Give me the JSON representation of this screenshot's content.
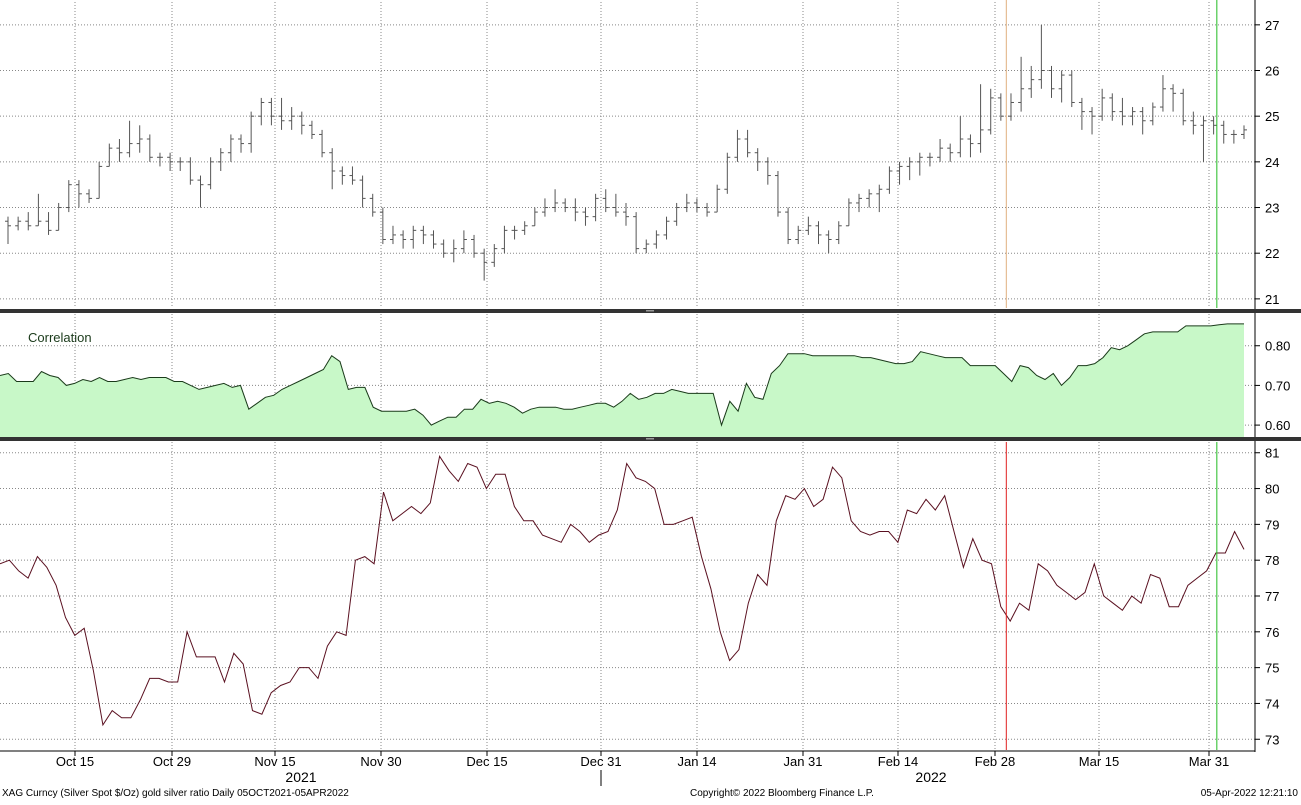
{
  "chart_data": [
    {
      "type": "ohlc",
      "panel": "top",
      "ylim": [
        20.8,
        27.5
      ],
      "yticks": [
        "21",
        "22",
        "23",
        "24",
        "25",
        "26",
        "27"
      ],
      "grid": true,
      "vlines": [
        {
          "x": "2022-03-01",
          "color": "#e0b080"
        },
        {
          "x": "2022-04-01",
          "color": "#22bb22"
        }
      ],
      "x_first": "2021-10-05",
      "x_last": "2022-04-05",
      "x_step_days_approx": 1.3,
      "ohlc": [
        [
          22.7,
          22.8,
          22.2,
          22.6
        ],
        [
          22.6,
          22.8,
          22.5,
          22.7
        ],
        [
          22.7,
          22.9,
          22.5,
          22.6
        ],
        [
          22.6,
          23.3,
          22.6,
          22.7
        ],
        [
          22.7,
          22.9,
          22.4,
          22.5
        ],
        [
          22.5,
          23.1,
          22.5,
          23.0
        ],
        [
          23.0,
          23.6,
          22.9,
          23.5
        ],
        [
          23.5,
          23.6,
          23.0,
          23.3
        ],
        [
          23.3,
          23.4,
          23.1,
          23.2
        ],
        [
          23.2,
          24.0,
          23.2,
          23.9
        ],
        [
          23.9,
          24.4,
          23.9,
          24.3
        ],
        [
          24.3,
          24.5,
          24.0,
          24.2
        ],
        [
          24.2,
          24.9,
          24.1,
          24.4
        ],
        [
          24.4,
          24.8,
          24.2,
          24.5
        ],
        [
          24.5,
          24.6,
          24.0,
          24.1
        ],
        [
          24.1,
          24.2,
          23.9,
          24.1
        ],
        [
          24.1,
          24.2,
          23.8,
          24.0
        ],
        [
          24.0,
          24.1,
          23.8,
          24.0
        ],
        [
          24.0,
          24.1,
          23.5,
          23.6
        ],
        [
          23.6,
          23.7,
          23.0,
          23.5
        ],
        [
          23.5,
          24.1,
          23.4,
          24.0
        ],
        [
          24.0,
          24.3,
          23.8,
          24.2
        ],
        [
          24.2,
          24.6,
          24.0,
          24.5
        ],
        [
          24.5,
          24.6,
          24.2,
          24.4
        ],
        [
          24.4,
          25.1,
          24.2,
          25.0
        ],
        [
          25.0,
          25.4,
          24.8,
          25.3
        ],
        [
          25.3,
          25.4,
          24.8,
          25.0
        ],
        [
          25.0,
          25.4,
          24.7,
          24.9
        ],
        [
          24.9,
          25.2,
          24.7,
          25.0
        ],
        [
          25.0,
          25.1,
          24.6,
          24.8
        ],
        [
          24.8,
          24.9,
          24.5,
          24.6
        ],
        [
          24.6,
          24.7,
          24.1,
          24.2
        ],
        [
          24.2,
          24.3,
          23.4,
          23.8
        ],
        [
          23.8,
          23.9,
          23.5,
          23.7
        ],
        [
          23.7,
          23.9,
          23.5,
          23.6
        ],
        [
          23.6,
          23.7,
          23.0,
          23.2
        ],
        [
          23.2,
          23.3,
          22.8,
          22.9
        ],
        [
          22.9,
          23.0,
          22.2,
          22.3
        ],
        [
          22.3,
          22.6,
          22.2,
          22.4
        ],
        [
          22.4,
          22.5,
          22.1,
          22.3
        ],
        [
          22.3,
          22.6,
          22.1,
          22.5
        ],
        [
          22.5,
          22.6,
          22.2,
          22.4
        ],
        [
          22.4,
          22.5,
          22.1,
          22.2
        ],
        [
          22.2,
          22.3,
          21.9,
          22.0
        ],
        [
          22.0,
          22.3,
          21.8,
          22.1
        ],
        [
          22.1,
          22.5,
          22.0,
          22.3
        ],
        [
          22.3,
          22.4,
          21.9,
          22.0
        ],
        [
          22.0,
          22.1,
          21.4,
          21.8
        ],
        [
          21.8,
          22.2,
          21.7,
          22.1
        ],
        [
          22.1,
          22.6,
          22.0,
          22.5
        ],
        [
          22.5,
          22.6,
          22.3,
          22.5
        ],
        [
          22.5,
          22.7,
          22.4,
          22.6
        ],
        [
          22.6,
          23.0,
          22.6,
          22.9
        ],
        [
          22.9,
          23.2,
          22.8,
          23.0
        ],
        [
          23.0,
          23.4,
          22.9,
          23.1
        ],
        [
          23.1,
          23.2,
          22.9,
          23.0
        ],
        [
          23.0,
          23.2,
          22.7,
          22.9
        ],
        [
          22.9,
          23.0,
          22.6,
          22.8
        ],
        [
          22.8,
          23.3,
          22.7,
          23.2
        ],
        [
          23.2,
          23.4,
          22.9,
          23.0
        ],
        [
          23.0,
          23.3,
          22.8,
          22.9
        ],
        [
          22.9,
          23.1,
          22.6,
          22.8
        ],
        [
          22.8,
          22.9,
          22.0,
          22.1
        ],
        [
          22.1,
          22.3,
          22.0,
          22.2
        ],
        [
          22.2,
          22.5,
          22.1,
          22.4
        ],
        [
          22.4,
          22.8,
          22.3,
          22.7
        ],
        [
          22.7,
          23.1,
          22.6,
          23.0
        ],
        [
          23.0,
          23.3,
          22.9,
          23.1
        ],
        [
          23.1,
          23.2,
          22.9,
          23.0
        ],
        [
          23.0,
          23.1,
          22.8,
          22.9
        ],
        [
          22.9,
          23.5,
          22.9,
          23.4
        ],
        [
          23.4,
          24.2,
          23.3,
          24.1
        ],
        [
          24.1,
          24.7,
          24.0,
          24.5
        ],
        [
          24.5,
          24.7,
          24.1,
          24.2
        ],
        [
          24.2,
          24.3,
          23.8,
          24.0
        ],
        [
          24.0,
          24.1,
          23.5,
          23.7
        ],
        [
          23.7,
          23.8,
          22.8,
          22.9
        ],
        [
          22.9,
          23.0,
          22.2,
          22.3
        ],
        [
          22.3,
          22.6,
          22.2,
          22.5
        ],
        [
          22.5,
          22.8,
          22.4,
          22.6
        ],
        [
          22.6,
          22.7,
          22.2,
          22.4
        ],
        [
          22.4,
          22.5,
          22.0,
          22.3
        ],
        [
          22.3,
          22.7,
          22.2,
          22.6
        ],
        [
          22.6,
          23.2,
          22.6,
          23.1
        ],
        [
          23.1,
          23.3,
          22.9,
          23.2
        ],
        [
          23.2,
          23.4,
          23.0,
          23.3
        ],
        [
          23.3,
          23.5,
          22.9,
          23.4
        ],
        [
          23.4,
          23.9,
          23.3,
          23.8
        ],
        [
          23.8,
          24.0,
          23.5,
          23.9
        ],
        [
          23.9,
          24.1,
          23.6,
          24.0
        ],
        [
          24.0,
          24.2,
          23.7,
          24.1
        ],
        [
          24.1,
          24.2,
          23.9,
          24.1
        ],
        [
          24.1,
          24.5,
          24.0,
          24.3
        ],
        [
          24.3,
          24.4,
          24.0,
          24.2
        ],
        [
          24.2,
          25.0,
          24.1,
          24.5
        ],
        [
          24.5,
          24.6,
          24.1,
          24.4
        ],
        [
          24.4,
          25.7,
          24.2,
          24.7
        ],
        [
          24.7,
          25.6,
          24.6,
          25.4
        ],
        [
          25.4,
          25.5,
          24.9,
          25.0
        ],
        [
          25.0,
          25.5,
          24.9,
          25.3
        ],
        [
          25.3,
          26.3,
          25.1,
          25.6
        ],
        [
          25.6,
          26.1,
          25.4,
          25.8
        ],
        [
          25.8,
          27.0,
          25.6,
          26.0
        ],
        [
          26.0,
          26.1,
          25.4,
          25.6
        ],
        [
          25.6,
          26.0,
          25.3,
          25.9
        ],
        [
          25.9,
          26.0,
          25.2,
          25.3
        ],
        [
          25.3,
          25.4,
          24.7,
          25.1
        ],
        [
          25.1,
          25.2,
          24.6,
          25.0
        ],
        [
          25.0,
          25.6,
          24.9,
          25.4
        ],
        [
          25.4,
          25.5,
          24.9,
          25.1
        ],
        [
          25.1,
          25.4,
          24.8,
          25.0
        ],
        [
          25.0,
          25.2,
          24.8,
          25.1
        ],
        [
          25.1,
          25.2,
          24.6,
          24.9
        ],
        [
          24.9,
          25.3,
          24.8,
          25.2
        ],
        [
          25.2,
          25.9,
          25.1,
          25.6
        ],
        [
          25.6,
          25.7,
          25.1,
          25.5
        ],
        [
          25.5,
          25.6,
          24.8,
          24.9
        ],
        [
          24.9,
          25.1,
          24.6,
          24.8
        ],
        [
          24.8,
          25.0,
          24.0,
          24.9
        ],
        [
          24.9,
          25.0,
          24.6,
          24.8
        ],
        [
          24.8,
          24.9,
          24.4,
          24.6
        ],
        [
          24.6,
          24.7,
          24.4,
          24.6
        ],
        [
          24.6,
          24.8,
          24.5,
          24.7
        ]
      ]
    },
    {
      "type": "area",
      "panel": "middle",
      "title": "Correlation",
      "ylim": [
        0.57,
        0.88
      ],
      "yticks": [
        "0.60",
        "0.70",
        "0.80"
      ],
      "grid": true,
      "fill_color": "#c8f8c8",
      "line_color": "#1a3a1a",
      "values": [
        0.725,
        0.73,
        0.71,
        0.71,
        0.71,
        0.735,
        0.725,
        0.72,
        0.7,
        0.705,
        0.715,
        0.71,
        0.72,
        0.71,
        0.71,
        0.715,
        0.72,
        0.715,
        0.72,
        0.72,
        0.72,
        0.71,
        0.71,
        0.7,
        0.69,
        0.695,
        0.7,
        0.705,
        0.695,
        0.7,
        0.64,
        0.655,
        0.67,
        0.675,
        0.69,
        0.7,
        0.71,
        0.72,
        0.73,
        0.74,
        0.775,
        0.76,
        0.69,
        0.695,
        0.695,
        0.645,
        0.635,
        0.635,
        0.635,
        0.635,
        0.64,
        0.625,
        0.6,
        0.61,
        0.62,
        0.62,
        0.64,
        0.64,
        0.665,
        0.655,
        0.66,
        0.655,
        0.645,
        0.63,
        0.64,
        0.645,
        0.645,
        0.645,
        0.64,
        0.64,
        0.645,
        0.65,
        0.655,
        0.655,
        0.645,
        0.66,
        0.68,
        0.665,
        0.67,
        0.68,
        0.68,
        0.69,
        0.685,
        0.68,
        0.68,
        0.68,
        0.68,
        0.6,
        0.66,
        0.635,
        0.705,
        0.67,
        0.665,
        0.73,
        0.75,
        0.78,
        0.78,
        0.78,
        0.775,
        0.775,
        0.775,
        0.775,
        0.775,
        0.775,
        0.77,
        0.77,
        0.765,
        0.76,
        0.755,
        0.755,
        0.76,
        0.785,
        0.78,
        0.775,
        0.77,
        0.77,
        0.77,
        0.75,
        0.75,
        0.75,
        0.75,
        0.73,
        0.71,
        0.75,
        0.745,
        0.725,
        0.715,
        0.73,
        0.7,
        0.72,
        0.75,
        0.75,
        0.755,
        0.77,
        0.795,
        0.79,
        0.8,
        0.815,
        0.83,
        0.835,
        0.835,
        0.835,
        0.835,
        0.85,
        0.85,
        0.85,
        0.85,
        0.853,
        0.855,
        0.855,
        0.855
      ]
    },
    {
      "type": "line",
      "panel": "bottom",
      "ylim": [
        72.7,
        81.3
      ],
      "yticks": [
        "73",
        "74",
        "75",
        "76",
        "77",
        "78",
        "79",
        "80",
        "81"
      ],
      "grid": true,
      "line_color": "#5a1020",
      "vlines": [
        {
          "x": "2022-03-01",
          "color": "#e02020"
        },
        {
          "x": "2022-04-01",
          "color": "#22bb22"
        }
      ],
      "values": [
        77.9,
        78.0,
        77.7,
        77.5,
        78.1,
        77.8,
        77.3,
        76.4,
        75.9,
        76.1,
        74.9,
        73.4,
        73.8,
        73.6,
        73.6,
        74.1,
        74.7,
        74.7,
        74.6,
        74.6,
        76.0,
        75.3,
        75.3,
        75.3,
        74.6,
        75.4,
        75.1,
        73.8,
        73.7,
        74.3,
        74.5,
        74.6,
        75.0,
        75.0,
        74.7,
        75.6,
        76.0,
        75.9,
        78.0,
        78.1,
        77.9,
        79.9,
        79.1,
        79.3,
        79.5,
        79.3,
        79.6,
        80.9,
        80.5,
        80.2,
        80.7,
        80.6,
        80.0,
        80.4,
        80.4,
        79.5,
        79.1,
        79.1,
        78.7,
        78.6,
        78.5,
        79.0,
        78.8,
        78.5,
        78.7,
        78.8,
        79.4,
        80.7,
        80.3,
        80.2,
        80.0,
        79.0,
        79.0,
        79.1,
        79.2,
        78.1,
        77.2,
        76.0,
        75.2,
        75.5,
        76.8,
        77.6,
        77.3,
        79.1,
        79.8,
        79.7,
        80.0,
        79.5,
        79.7,
        80.6,
        80.3,
        79.1,
        78.8,
        78.7,
        78.8,
        78.8,
        78.5,
        79.4,
        79.3,
        79.7,
        79.4,
        79.8,
        78.8,
        77.8,
        78.6,
        78.0,
        77.9,
        76.7,
        76.3,
        76.8,
        76.6,
        77.9,
        77.7,
        77.3,
        77.1,
        76.9,
        77.1,
        77.9,
        77.0,
        76.8,
        76.6,
        77.0,
        76.8,
        77.6,
        77.5,
        76.7,
        76.7,
        77.3,
        77.5,
        77.7,
        78.2,
        78.2,
        78.8,
        78.3
      ]
    }
  ],
  "x_axis": {
    "labels": [
      "Oct 15",
      "Oct 29",
      "Nov 15",
      "Nov 30",
      "Dec 15",
      "Dec 31",
      "Jan 14",
      "Jan 31",
      "Feb 14",
      "Feb 28",
      "Mar 15",
      "Mar 31"
    ],
    "years": [
      "2021",
      "2022"
    ]
  },
  "footer": {
    "left": "XAG Curncy (Silver Spot  $/Oz) gold silver ratio  Daily 05OCT2021-05APR2022",
    "center": "Copyright© 2022 Bloomberg Finance L.P.",
    "right": "05-Apr-2022 12:21:10"
  },
  "colors": {
    "grid": "#888888",
    "panel_divider": "#333333",
    "ohlc": "#555555"
  }
}
